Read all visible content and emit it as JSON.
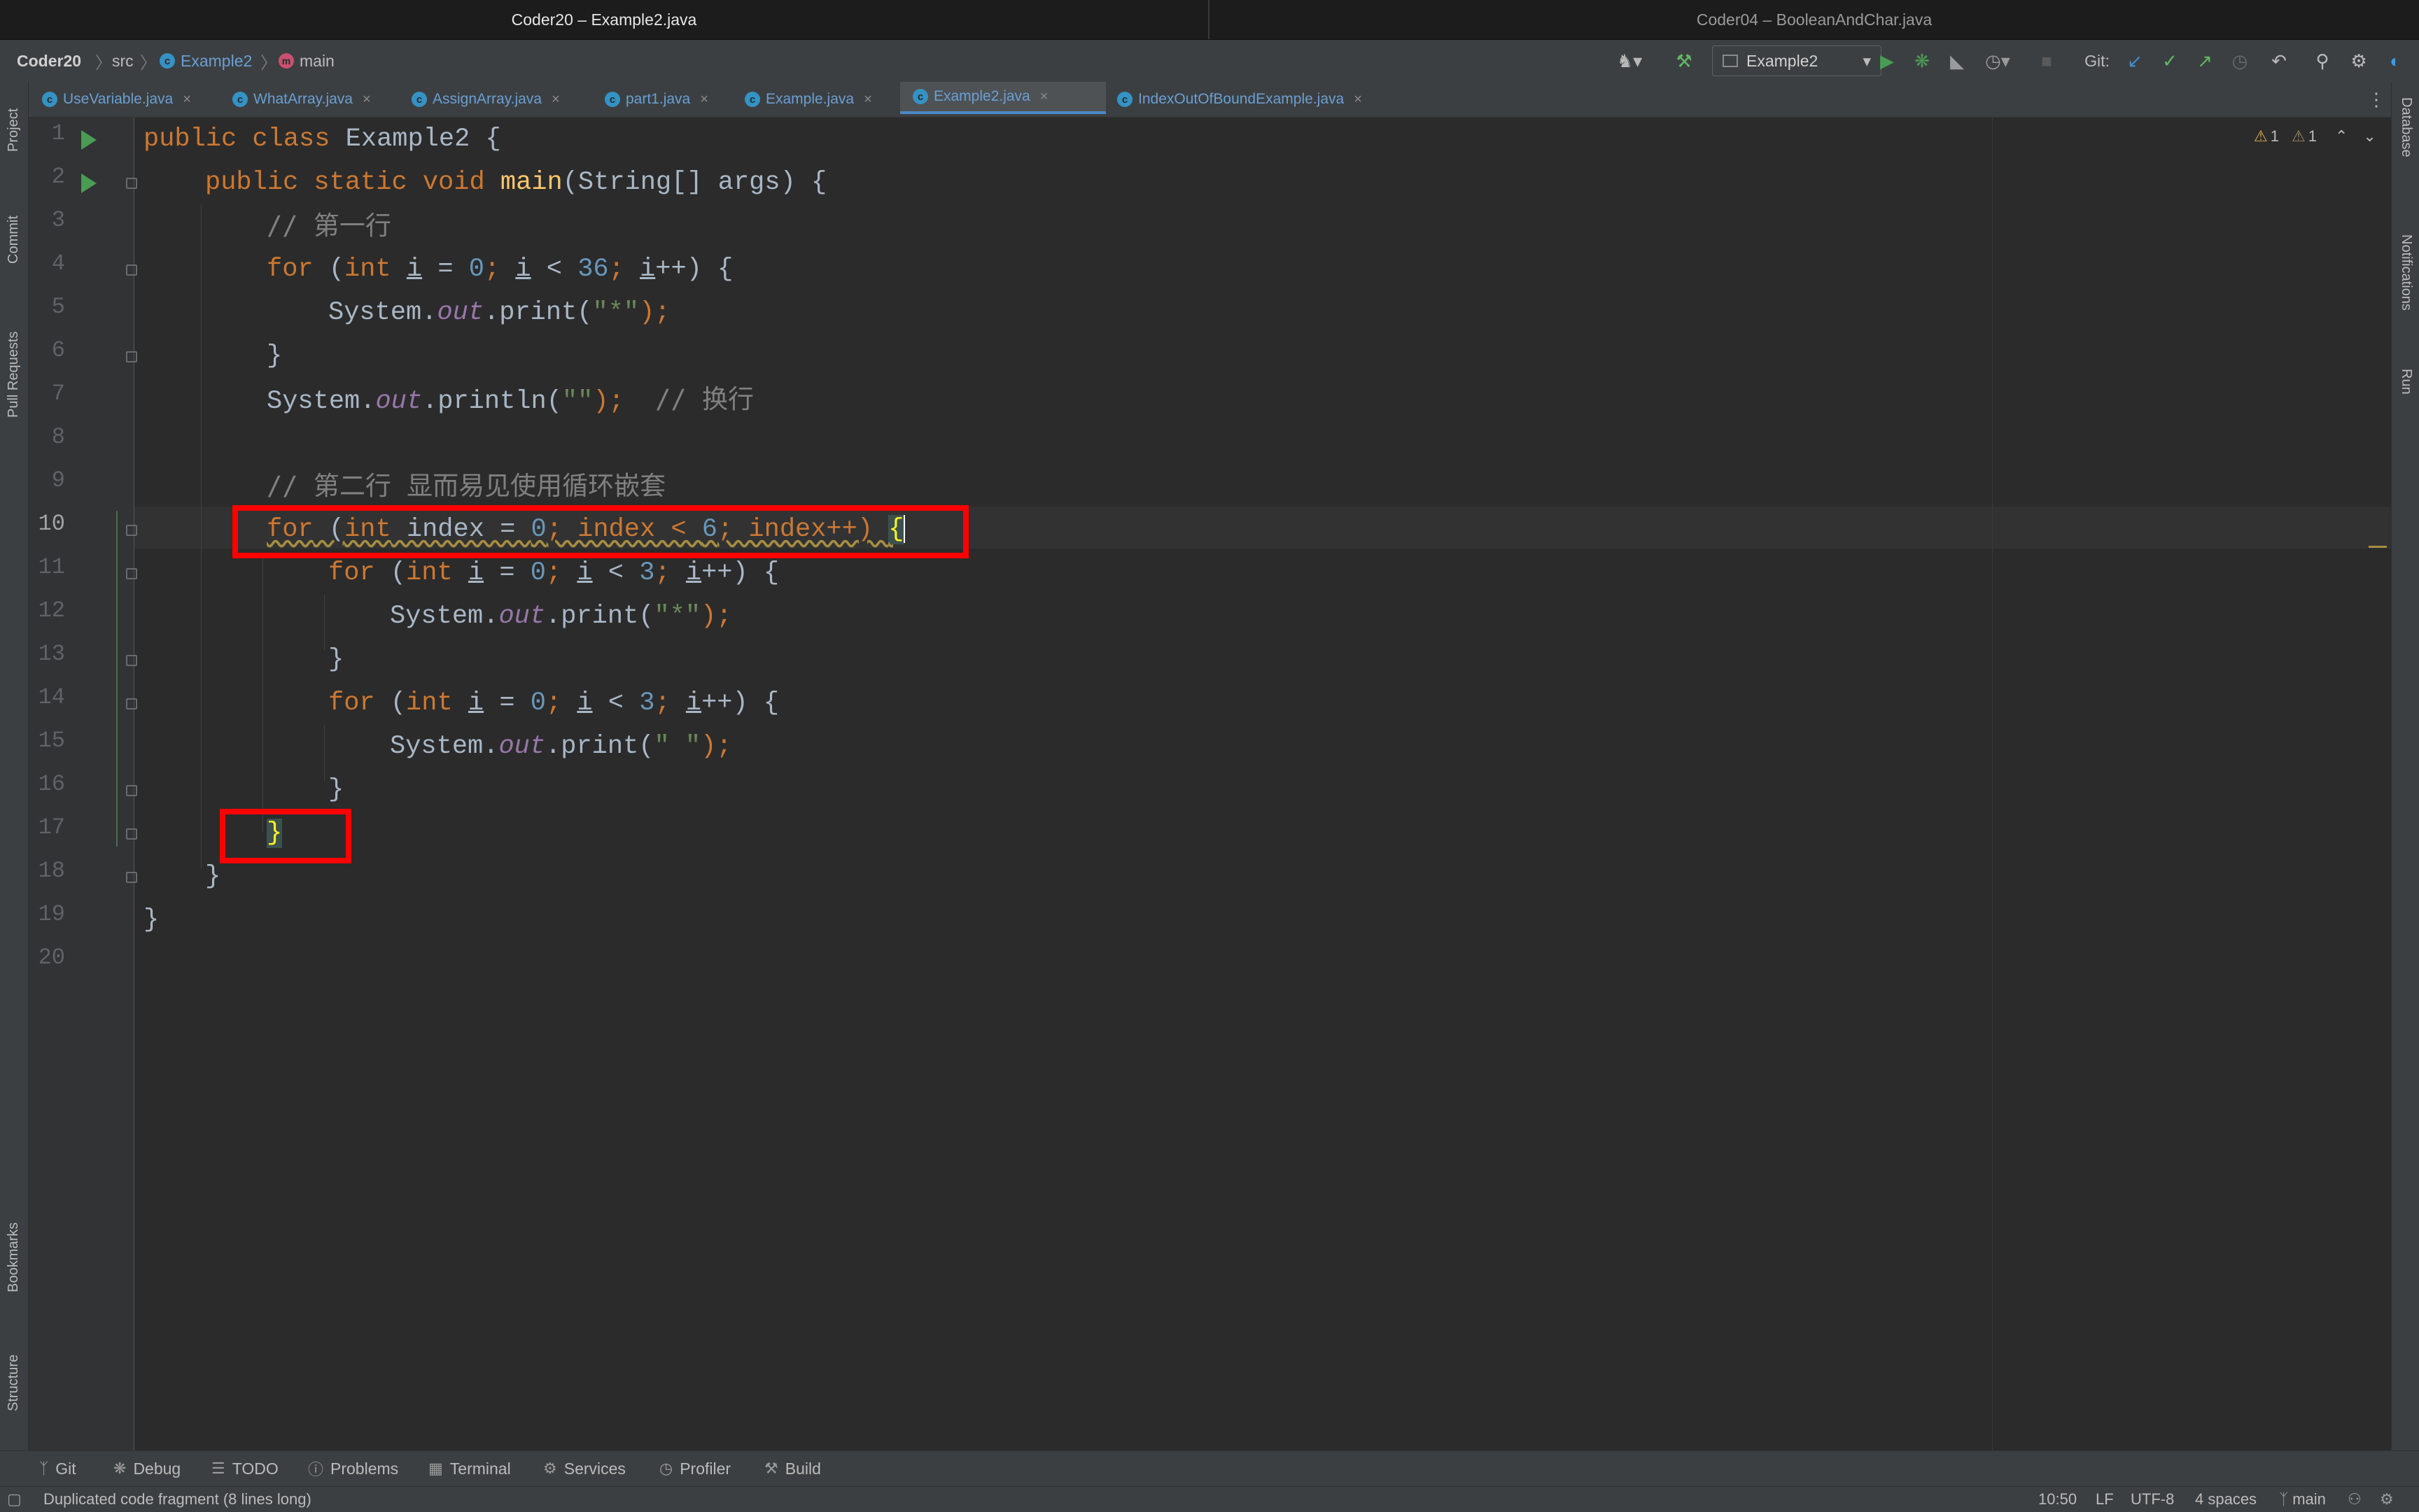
{
  "window_tabs": [
    "Coder20 – Example2.java",
    "Coder04 – BooleanAndChar.java"
  ],
  "breadcrumb": {
    "project": "Coder20",
    "folder": "src",
    "class": "Example2",
    "method": "main"
  },
  "toolbar": {
    "run_config": "Example2",
    "git_label": "Git:"
  },
  "file_tabs": [
    {
      "label": "UseVariable.java"
    },
    {
      "label": "WhatArray.java"
    },
    {
      "label": "AssignArray.java"
    },
    {
      "label": "part1.java"
    },
    {
      "label": "Example.java"
    },
    {
      "label": "Example2.java",
      "active": true
    },
    {
      "label": "IndexOutOfBoundExample.java"
    }
  ],
  "left_stripe": [
    "Project",
    "Commit",
    "Pull Requests",
    "Bookmarks",
    "Structure"
  ],
  "right_stripe": [
    "Database",
    "Notifications",
    "Run"
  ],
  "inspection": {
    "warnings": "1",
    "weak_warnings": "1"
  },
  "editor": {
    "line_numbers": [
      "1",
      "2",
      "3",
      "4",
      "5",
      "6",
      "7",
      "8",
      "9",
      "10",
      "11",
      "12",
      "13",
      "14",
      "15",
      "16",
      "17",
      "18",
      "19",
      "20"
    ],
    "current_line": 10,
    "code": {
      "l1": {
        "kw": "public class",
        "name": "Example2",
        "rest": " {"
      },
      "l2": {
        "kw": "public static void",
        "fn": "main",
        "rest": "(String[] args) {"
      },
      "l3": "// 第一行",
      "l4": {
        "kw": "for",
        "a": " (",
        "kw2": "int",
        "b": " ",
        "var": "i",
        "c": " = ",
        "n1": "0",
        "d": "; ",
        "var2": "i",
        "e": " < ",
        "n2": "36",
        "f": "; ",
        "var3": "i",
        "g": "++) {"
      },
      "l5": {
        "a": "System.",
        "st": "out",
        "b": ".print(",
        "s": "\"*\"",
        "c": ");"
      },
      "l6": "}",
      "l7": {
        "a": "System.",
        "st": "out",
        "b": ".println(",
        "s": "\"\"",
        "c": ");  ",
        "cm": "// 换行"
      },
      "l9": "// 第二行 显而易见使用循环嵌套",
      "l10": {
        "kw": "for",
        "a": " (",
        "kw2": "int",
        "b": " index = ",
        "n1": "0",
        "c": "; index < ",
        "n2": "6",
        "d": "; index++) ",
        "brace": "{"
      },
      "l11": {
        "kw": "for",
        "a": " (",
        "kw2": "int",
        "b": " ",
        "var": "i",
        "c": " = ",
        "n1": "0",
        "d": "; ",
        "var2": "i",
        "e": " < ",
        "n2": "3",
        "f": "; ",
        "var3": "i",
        "g": "++) {"
      },
      "l12": {
        "a": "System.",
        "st": "out",
        "b": ".print(",
        "s": "\"*\"",
        "c": ");"
      },
      "l13": "}",
      "l14": {
        "kw": "for",
        "a": " (",
        "kw2": "int",
        "b": " ",
        "var": "i",
        "c": " = ",
        "n1": "0",
        "d": "; ",
        "var2": "i",
        "e": " < ",
        "n2": "3",
        "f": "; ",
        "var3": "i",
        "g": "++) {"
      },
      "l15": {
        "a": "System.",
        "st": "out",
        "b": ".print(",
        "s": "\" \"",
        "c": ");"
      },
      "l16": "}",
      "l17": "}",
      "l18": "}",
      "l19": "}"
    }
  },
  "bottom_tools": [
    "Git",
    "Debug",
    "TODO",
    "Problems",
    "Terminal",
    "Services",
    "Profiler",
    "Build"
  ],
  "status": {
    "message": "Duplicated code fragment (8 lines long)",
    "position": "10:50",
    "line_sep": "LF",
    "encoding": "UTF-8",
    "indent": "4 spaces",
    "branch": "main"
  },
  "colors": {
    "keyword": "#cc7832",
    "string": "#6a8759",
    "number": "#6897bb",
    "comment": "#808080",
    "annotation_box": "#ff0000"
  }
}
